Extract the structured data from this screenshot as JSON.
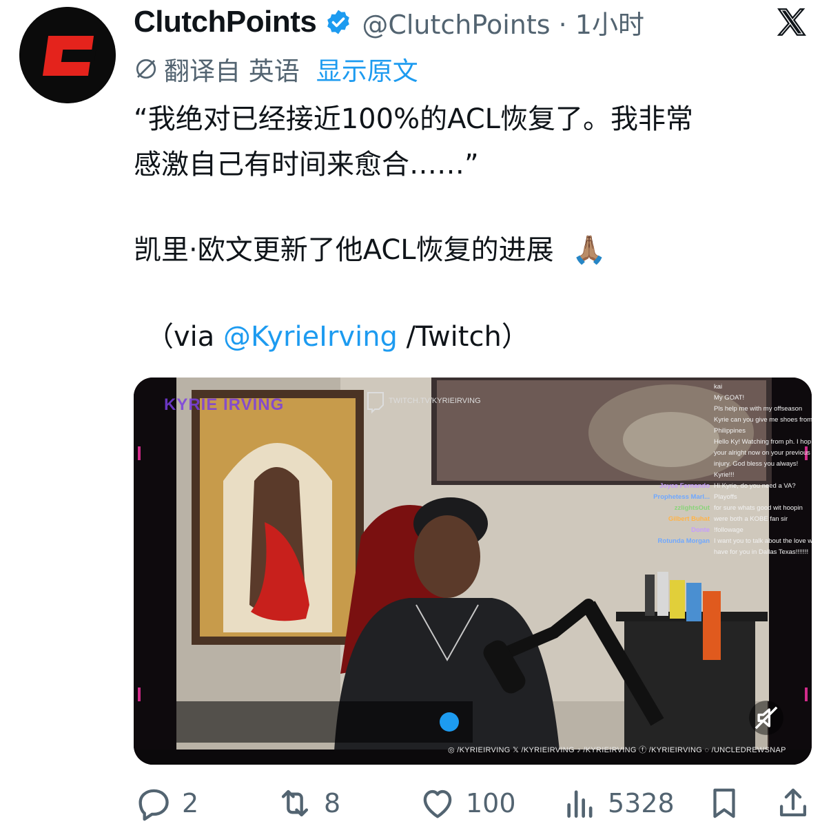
{
  "author": {
    "name": "ClutchPoints",
    "handle_time": "@ClutchPoints · 1小时",
    "avatar_color": "#e4231c",
    "verified": true
  },
  "translation": {
    "label": "翻译自 英语",
    "show_original": "显示原文"
  },
  "tweet": {
    "line1": "“我绝对已经接近100%的ACL恢复了。我非常",
    "line2": "感激自己有时间来愈合……”",
    "line3": "凯里·欧文更新了他ACL恢复的进展",
    "emoji": "🙏🏽",
    "via_prefix": "（via ",
    "via_mention": "@KyrieIrving",
    "via_suffix": " /Twitch）"
  },
  "media": {
    "channel_title": "KYRIE IRVING",
    "twitch_url": "TWITCH.TV/KYRIEIRVING",
    "social_bar": "◎ /KYRIEIRVING   𝕏 /KYRIEIRVING   ♪ /KYRIEIRVING   ⓕ /KYRIEIRVING   ◌ /UNCLEDREWSNAP",
    "chat": [
      {
        "user": "",
        "msg": "kai"
      },
      {
        "user": "",
        "msg": "My GOAT!"
      },
      {
        "user": "",
        "msg": "Pls help me with my offseason"
      },
      {
        "user": "",
        "msg": "Kyrie can you give me shoes from"
      },
      {
        "user": "",
        "msg": "Philippines"
      },
      {
        "user": "",
        "msg": "Hello Ky! Watching from ph. I hop"
      },
      {
        "user": "",
        "msg": "your alright now on your previous"
      },
      {
        "user": "",
        "msg": "injury. God bless you always!"
      },
      {
        "user": "",
        "msg": "Kyrie!!!"
      },
      {
        "user": "Joyce Fernando",
        "msg": "Hi Kyrie, do you need a VA?"
      },
      {
        "user": "Prophetess Marl...",
        "msg": "Playoffs"
      },
      {
        "user": "zzlightsOut",
        "msg": "for sure whats good wit hoopin"
      },
      {
        "user": "Gilbert Buhat",
        "msg": "were both a KOBE fan sir"
      },
      {
        "user": "",
        "msg": ""
      },
      {
        "user": "Donte",
        "msg": "!followage"
      },
      {
        "user": "Rotunda Morgan",
        "msg": "I want you to talk about the love w"
      },
      {
        "user": "",
        "msg": "have for you in Dallas Texas!!!!!!!"
      }
    ]
  },
  "actions": {
    "replies": "2",
    "reposts": "8",
    "likes": "100",
    "views": "5328"
  }
}
